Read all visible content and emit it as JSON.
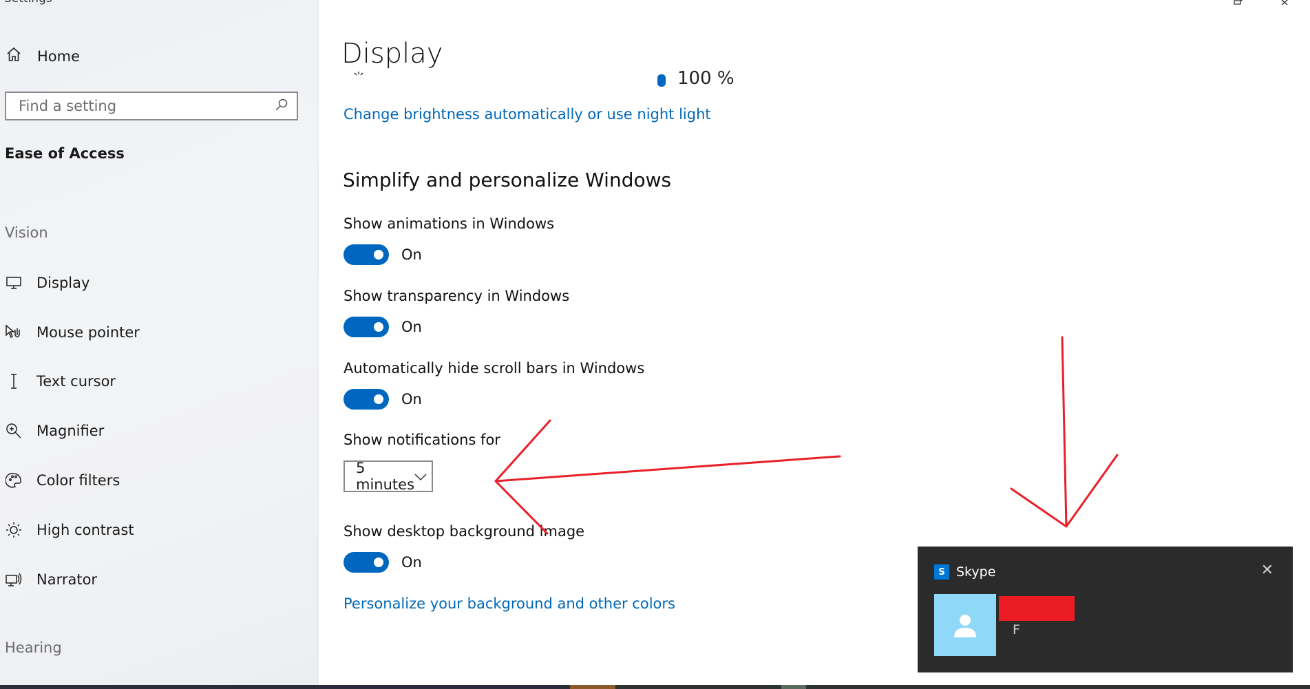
{
  "window": {
    "title": "Settings"
  },
  "sidebar": {
    "home_label": "Home",
    "search_placeholder": "Find a setting",
    "section_title": "Ease of Access",
    "groups": {
      "vision": "Vision",
      "hearing": "Hearing"
    },
    "items": [
      {
        "label": "Display",
        "icon": "monitor-icon"
      },
      {
        "label": "Mouse pointer",
        "icon": "mouse-pointer-icon"
      },
      {
        "label": "Text cursor",
        "icon": "text-cursor-icon"
      },
      {
        "label": "Magnifier",
        "icon": "magnifier-icon"
      },
      {
        "label": "Color filters",
        "icon": "palette-icon"
      },
      {
        "label": "High contrast",
        "icon": "sun-icon"
      },
      {
        "label": "Narrator",
        "icon": "narrator-icon"
      }
    ]
  },
  "main": {
    "page_title": "Display",
    "brightness_link": "Change brightness automatically or use night light",
    "section_title": "Simplify and personalize Windows",
    "settings": [
      {
        "label": "Show animations in Windows",
        "state": "On"
      },
      {
        "label": "Show transparency in Windows",
        "state": "On"
      },
      {
        "label": "Automatically hide scroll bars in Windows",
        "state": "On"
      }
    ],
    "notifications": {
      "label": "Show notifications for",
      "selected": "5 minutes"
    },
    "background_setting": {
      "label": "Show desktop background image",
      "state": "On"
    },
    "personalize_link": "Personalize your background and other colors"
  },
  "toast": {
    "app_name": "Skype",
    "message": "F"
  },
  "colors": {
    "accent": "#0067c0",
    "link": "#0067b8",
    "toast_bg": "#2b2b2b",
    "annotation": "#e8202a"
  }
}
